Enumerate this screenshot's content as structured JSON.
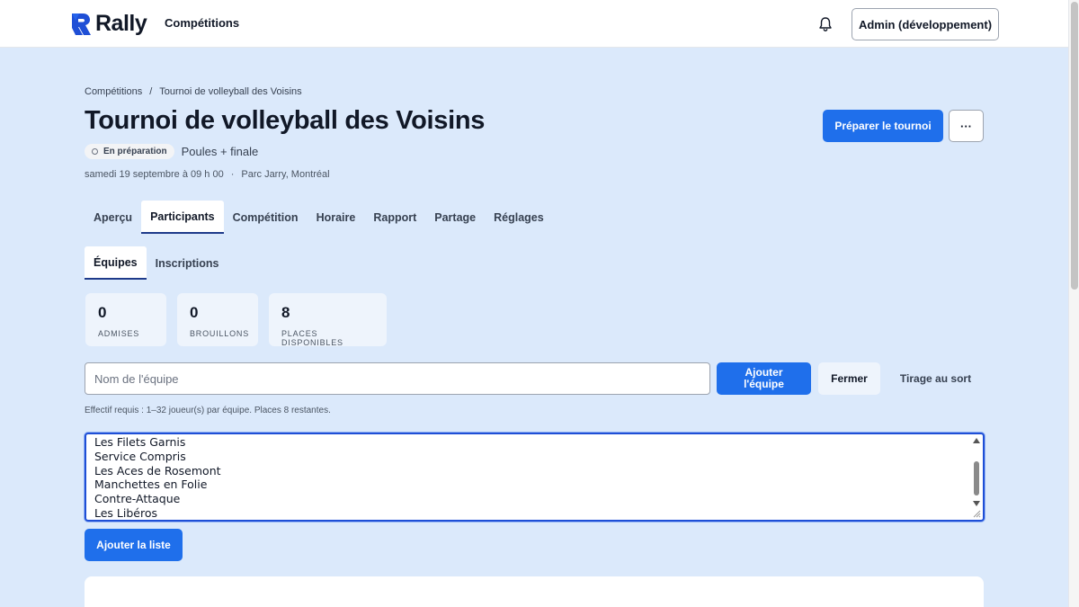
{
  "header": {
    "brand": "Rally",
    "nav_competitions": "Compétitions",
    "user_button": "Admin (développement)"
  },
  "breadcrumb": {
    "root": "Compétitions",
    "separator": "/",
    "current": "Tournoi de volleyball des Voisins"
  },
  "tournament": {
    "title": "Tournoi de volleyball des Voisins",
    "status": "En préparation",
    "format": "Poules + finale",
    "date": "samedi 19 septembre à 09 h 00",
    "meta_separator": "·",
    "location": "Parc Jarry, Montréal"
  },
  "actions": {
    "prepare": "Préparer le tournoi",
    "more": "···"
  },
  "tabs": [
    "Aperçu",
    "Participants",
    "Compétition",
    "Horaire",
    "Rapport",
    "Partage",
    "Réglages"
  ],
  "active_tab": "Participants",
  "subtabs": [
    "Équipes",
    "Inscriptions"
  ],
  "active_subtab": "Équipes",
  "stats": [
    {
      "value": "0",
      "label": "ADMISES"
    },
    {
      "value": "0",
      "label": "BROUILLONS"
    },
    {
      "value": "8",
      "label": "PLACES DISPONIBLES"
    }
  ],
  "team_form": {
    "placeholder": "Nom de l'équipe",
    "value": "",
    "add_label_line1": "Ajouter",
    "add_label_line2": "l'équipe",
    "close_label": "Fermer",
    "draw_label": "Tirage au sort",
    "helper": "Effectif requis : 1–32 joueur(s) par équipe. Places 8 restantes."
  },
  "bulk_list": {
    "lines": [
      "Les Filets Garnis",
      "Service Compris",
      "Les Aces de Rosemont",
      "Manchettes en Folie",
      "Contre-Attaque",
      "Les Libéros"
    ],
    "submit_label": "Ajouter la liste"
  },
  "colors": {
    "primary": "#1f6feb",
    "page_bg": "#dbe9fb",
    "focus_ring": "#1f4fd6"
  }
}
